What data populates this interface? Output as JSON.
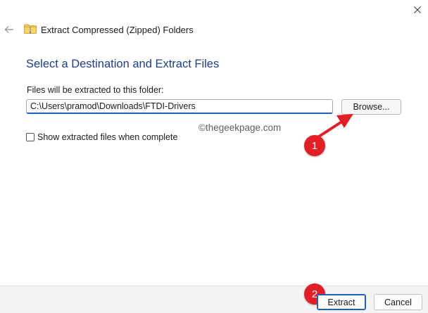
{
  "window": {
    "title": "Extract Compressed (Zipped) Folders",
    "title_icon": "zip-folder-icon",
    "close_icon": "close-icon",
    "back_icon": "back-arrow-icon"
  },
  "content": {
    "heading": "Select a Destination and Extract Files",
    "path_label": "Files will be extracted to this folder:",
    "path_value": "C:\\Users\\pramod\\Downloads\\FTDI-Drivers",
    "browse_label": "Browse...",
    "checkbox_label": "Show extracted files when complete",
    "checkbox_checked": false,
    "watermark": "©thegeekpage.com"
  },
  "footer": {
    "extract_label": "Extract",
    "cancel_label": "Cancel"
  },
  "annotations": {
    "badge1": "1",
    "badge2": "2",
    "color": "#e31e24"
  },
  "colors": {
    "heading": "#1f3c88",
    "accent": "#1f5fbf"
  }
}
